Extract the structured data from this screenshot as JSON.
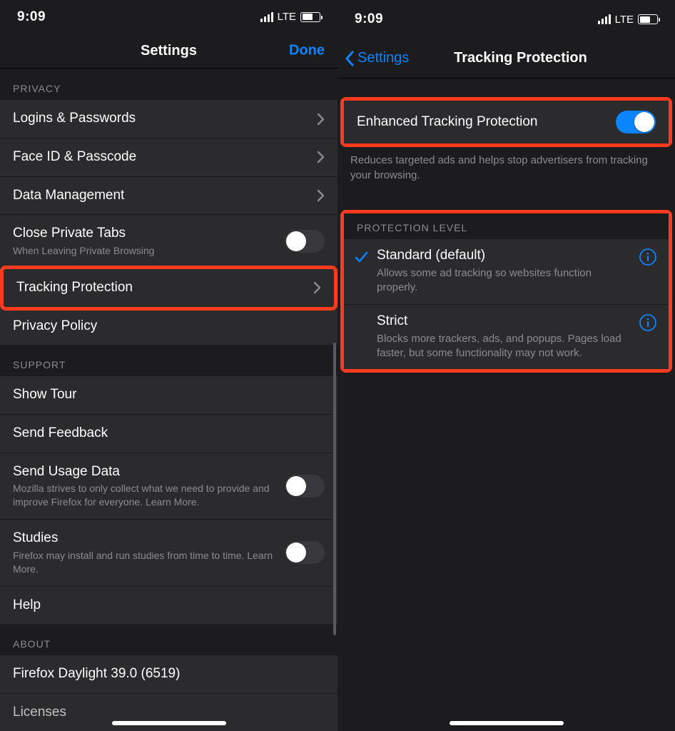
{
  "status": {
    "time": "9:09",
    "network": "LTE"
  },
  "left": {
    "nav": {
      "title": "Settings",
      "done": "Done"
    },
    "privacy": {
      "header": "PRIVACY",
      "items": {
        "logins": "Logins & Passwords",
        "faceid": "Face ID & Passcode",
        "datamgmt": "Data Management",
        "closeprivate": {
          "title": "Close Private Tabs",
          "sub": "When Leaving Private Browsing"
        },
        "tracking": "Tracking Protection",
        "policy": "Privacy Policy"
      }
    },
    "support": {
      "header": "SUPPORT",
      "items": {
        "tour": "Show Tour",
        "feedback": "Send Feedback",
        "usage": {
          "title": "Send Usage Data",
          "sub": "Mozilla strives to only collect what we need to provide and improve Firefox for everyone. Learn More."
        },
        "studies": {
          "title": "Studies",
          "sub": "Firefox may install and run studies from time to time. Learn More."
        },
        "help": "Help"
      }
    },
    "about": {
      "header": "ABOUT",
      "version": "Firefox Daylight 39.0 (6519)",
      "licenses": "Licenses"
    }
  },
  "right": {
    "nav": {
      "back": "Settings",
      "title": "Tracking Protection"
    },
    "etp": {
      "title": "Enhanced Tracking Protection",
      "desc": "Reduces targeted ads and helps stop advertisers from tracking your browsing."
    },
    "level": {
      "header": "PROTECTION LEVEL",
      "standard": {
        "title": "Standard (default)",
        "desc": "Allows some ad tracking so websites function properly."
      },
      "strict": {
        "title": "Strict",
        "desc": "Blocks more trackers, ads, and popups. Pages load faster, but some functionality may not work."
      }
    }
  }
}
